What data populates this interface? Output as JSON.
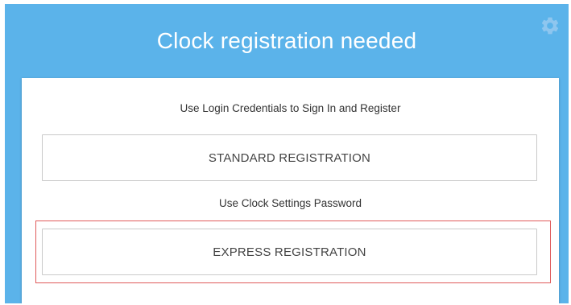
{
  "header": {
    "title": "Clock registration needed",
    "settings_icon": "gear-icon"
  },
  "card": {
    "standard_hint": "Use Login Credentials to Sign In and Register",
    "standard_button_label": "STANDARD REGISTRATION",
    "express_hint": "Use Clock Settings Password",
    "express_button_label": "EXPRESS REGISTRATION"
  },
  "colors": {
    "background": "#5bb3ea",
    "card": "#ffffff",
    "highlight": "#e05a5a"
  }
}
